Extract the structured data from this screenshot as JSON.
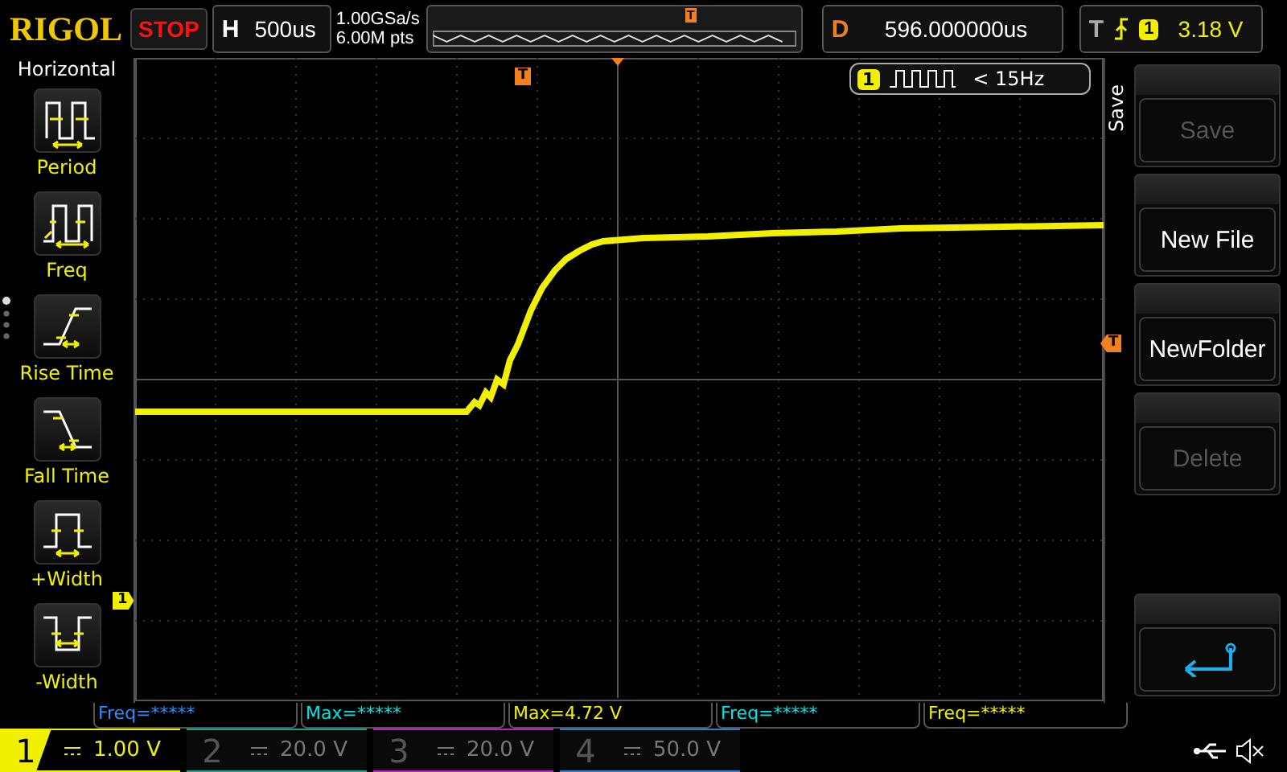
{
  "brand": "RIGOL",
  "run_state": "STOP",
  "timebase": {
    "label": "H",
    "value": "500us"
  },
  "acquisition": {
    "sample_rate": "1.00GSa/s",
    "memory_depth": "6.00M pts"
  },
  "memory_marker": "T",
  "delay": {
    "label": "D",
    "value": "596.000000us"
  },
  "trigger": {
    "label": "T",
    "source": "1",
    "level": "3.18 V"
  },
  "measure_menu": {
    "title": "Horizontal",
    "items": [
      {
        "label": "Period",
        "kind": "period"
      },
      {
        "label": "Freq",
        "kind": "freq"
      },
      {
        "label": "Rise Time",
        "kind": "rise"
      },
      {
        "label": "Fall Time",
        "kind": "fall"
      },
      {
        "label": "+Width",
        "kind": "pwidth"
      },
      {
        "label": "-Width",
        "kind": "nwidth"
      }
    ]
  },
  "counter": {
    "channel": "1",
    "reading": "< 15Hz"
  },
  "markers": {
    "trigger_position": "T",
    "trigger_level": "T",
    "channel": "1"
  },
  "softkeys": {
    "title": "Save",
    "buttons": [
      {
        "kind": "text",
        "label": "Save",
        "disabled": true
      },
      {
        "kind": "text",
        "label": "New File",
        "disabled": false
      },
      {
        "kind": "text",
        "label": "NewFolder",
        "disabled": false
      },
      {
        "kind": "text",
        "label": "Delete",
        "disabled": true
      },
      {
        "kind": "back",
        "disabled": false
      }
    ]
  },
  "measurements": [
    {
      "text": "Freq=*****",
      "color": "#2a8cff"
    },
    {
      "text": "Max=*****",
      "color": "#00e5e5"
    },
    {
      "text": "Max=4.72 V",
      "color": "#f0f000"
    },
    {
      "text": "Freq=*****",
      "color": "#00e5e5"
    },
    {
      "text": "Freq=*****",
      "color": "#f0f000"
    }
  ],
  "channels": [
    {
      "number": "1",
      "scale": "1.00 V",
      "active": true,
      "color": "#f0f000"
    },
    {
      "number": "2",
      "scale": "20.0 V",
      "active": false,
      "color": "#1fa08c"
    },
    {
      "number": "3",
      "scale": "20.0 V",
      "active": false,
      "color": "#c020c0"
    },
    {
      "number": "4",
      "scale": "50.0 V",
      "active": false,
      "color": "#2a7fd0"
    }
  ]
}
